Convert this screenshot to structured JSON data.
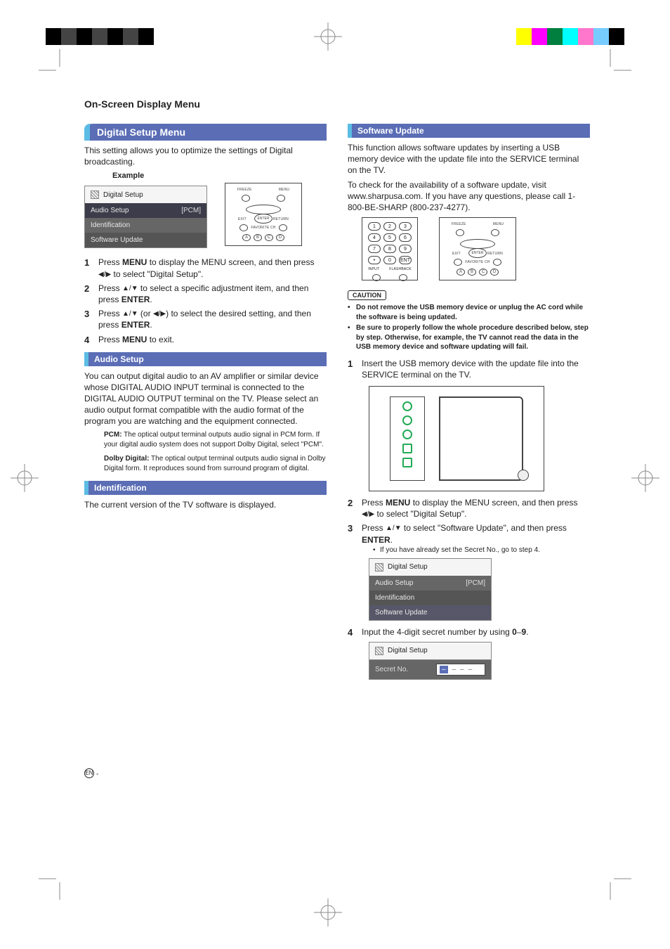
{
  "header": "On-Screen Display Menu",
  "mainTitle": "Digital Setup Menu",
  "introLeft": "This setting allows you to optimize the settings of Digital broadcasting.",
  "exampleLabel": "Example",
  "menuBox1": {
    "title": "Digital Setup",
    "rows": [
      {
        "label": "Audio Setup",
        "value": "[PCM]"
      },
      {
        "label": "Identification",
        "value": ""
      },
      {
        "label": "Software Update",
        "value": ""
      }
    ]
  },
  "remoteLabels": {
    "freeze": "FREEZE",
    "menu": "MENU",
    "exit": "EXIT",
    "return": "RETURN",
    "fav": "FAVORITE CH",
    "enter": "ENTER",
    "a": "A",
    "b": "B",
    "c": "C",
    "d": "D",
    "input": "INPUT",
    "flashback": "FLASHBACK",
    "ent": "ENT"
  },
  "stepsLeft": [
    {
      "n": "1",
      "text_pre": "Press ",
      "bold1": "MENU",
      "text_mid": " to display the MENU screen, and then press ",
      "arrows": "◀/▶",
      "text_post": " to select \"Digital Setup\"."
    },
    {
      "n": "2",
      "text_pre": "Press ",
      "arrows": "▲/▼",
      "text_mid": " to select a specific adjustment item, and then press ",
      "bold1": "ENTER",
      "text_post": "."
    },
    {
      "n": "3",
      "text_pre": "Press ",
      "arrows": "▲/▼",
      "paren": " (or ",
      "arrows2": "◀/▶",
      "paren2": ") to select the desired setting, and then press ",
      "bold1": "ENTER",
      "text_post": "."
    },
    {
      "n": "4",
      "text_pre": "Press ",
      "bold1": "MENU",
      "text_post": " to exit."
    }
  ],
  "audioSetup": {
    "title": "Audio Setup",
    "body": "You can output digital audio to an AV amplifier or similar device whose DIGITAL AUDIO INPUT terminal is connected to the DIGITAL AUDIO OUTPUT terminal on the TV. Please select an audio output format compatible with the audio format of the program you are watching and the equipment connected.",
    "pcm_label": "PCM:",
    "pcm_text": " The optical output terminal outputs audio signal in PCM form. If your digital audio system does not support Dolby Digital, select \"PCM\".",
    "dd_label": "Dolby Digital:",
    "dd_text": " The optical output terminal outputs audio signal in Dolby Digital form. It reproduces sound from surround program of digital."
  },
  "identification": {
    "title": "Identification",
    "body": "The current version of the TV software is displayed."
  },
  "softwareUpdate": {
    "title": "Software Update",
    "p1": "This function allows software updates by inserting a USB memory device with the update file into the SERVICE terminal on the TV.",
    "p2": "To check for the availability of a software update, visit www.sharpusa.com. If you have any questions, please call 1-800-BE-SHARP (800-237-4277).",
    "cautionLabel": "CAUTION",
    "cautions": [
      "Do not remove the USB memory device or unplug the AC cord while the software is being updated.",
      "Be sure to properly follow the whole procedure described below, step by step. Otherwise, for example, the TV cannot read the data in the USB memory device and software updating will fail."
    ],
    "steps": [
      {
        "n": "1",
        "text": "Insert the USB memory device with the update file into the SERVICE terminal on the TV."
      },
      {
        "n": "2",
        "pre": "Press ",
        "b1": "MENU",
        "mid": " to display the MENU screen, and then press ",
        "arr": "◀/▶",
        "post": " to select \"Digital Setup\"."
      },
      {
        "n": "3",
        "pre": "Press ",
        "arr": "▲/▼",
        "mid": " to select \"Software Update\", and then press ",
        "b1": "ENTER",
        "post": ".",
        "sub": "If you have already set the Secret No., go to step 4."
      },
      {
        "n": "4",
        "pre": "Input the 4-digit secret number by using ",
        "b1": "0",
        "dash": "–",
        "b2": "9",
        "post": "."
      }
    ]
  },
  "menuBox2": {
    "title": "Digital Setup",
    "rows": [
      {
        "label": "Audio Setup",
        "value": "[PCM]"
      },
      {
        "label": "Identification",
        "value": ""
      },
      {
        "label": "Software Update",
        "value": ""
      }
    ]
  },
  "secretBox": {
    "title": "Digital Setup",
    "label": "Secret No.",
    "mask": "– – – –"
  },
  "keypad": [
    "1",
    "2",
    "3",
    "4",
    "5",
    "6",
    "7",
    "8",
    "9",
    "•",
    "0",
    "ENT"
  ],
  "enBadge": "EN"
}
